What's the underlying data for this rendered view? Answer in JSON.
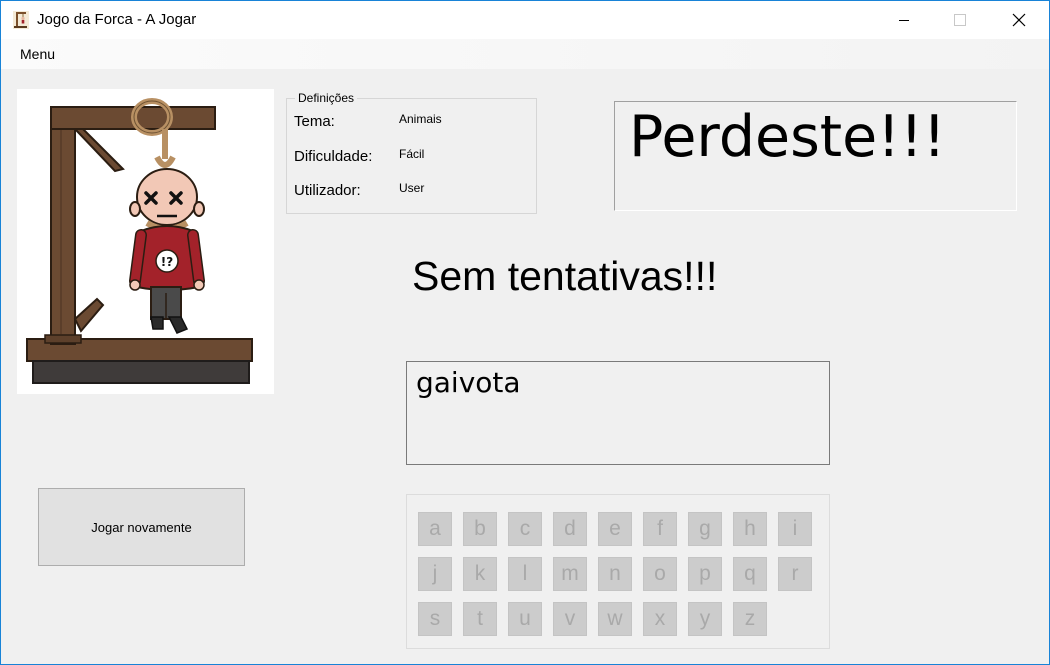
{
  "window": {
    "title": "Jogo da Forca - A Jogar"
  },
  "menu": {
    "items": [
      "Menu"
    ]
  },
  "settings": {
    "legend": "Definições",
    "rows": [
      {
        "label": "Tema:",
        "value": "Animais"
      },
      {
        "label": "Dificuldade:",
        "value": "Fácil"
      },
      {
        "label": "Utilizador:",
        "value": "User"
      }
    ]
  },
  "result": {
    "text": "Perdeste!!!"
  },
  "status": {
    "text": "Sem tentativas!!!"
  },
  "word": {
    "text": "gaivota"
  },
  "actions": {
    "replay_label": "Jogar novamente"
  },
  "keyboard": {
    "letters": [
      "a",
      "b",
      "c",
      "d",
      "e",
      "f",
      "g",
      "h",
      "i",
      "j",
      "k",
      "l",
      "m",
      "n",
      "o",
      "p",
      "q",
      "r",
      "s",
      "t",
      "u",
      "v",
      "w",
      "x",
      "y",
      "z"
    ],
    "enabled": false
  },
  "colors": {
    "accent_border": "#1883d7",
    "key_disabled_bg": "#cccccc",
    "key_disabled_text": "#a9a9a9",
    "shirt": "#a3222a"
  },
  "icons": [
    "hangman-app-icon",
    "minimize-icon",
    "maximize-icon",
    "close-icon",
    "hangman-illustration"
  ]
}
